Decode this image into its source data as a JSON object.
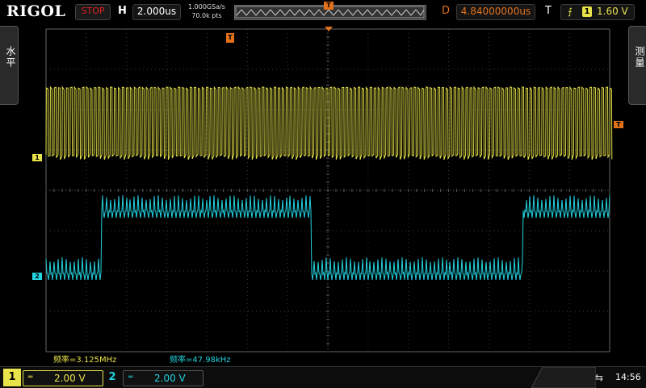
{
  "brand": "RIGOL",
  "status": {
    "run_state": "STOP",
    "run_color": "#e02020"
  },
  "horizontal": {
    "label": "H",
    "timebase": "2.000us",
    "sample_rate": "1.000GSa/s",
    "points": "70.0k pts"
  },
  "delay": {
    "label": "D",
    "value": "4.84000000us"
  },
  "trigger": {
    "label": "T",
    "edge_icon": "rising-edge-icon",
    "source": "1",
    "level": "1.60 V"
  },
  "side_tabs": {
    "left": "水平",
    "right": "测量"
  },
  "channels": [
    {
      "number": "1",
      "coupling": "DC",
      "coupling_symbol": "═",
      "scale": "2.00 V",
      "color": "#e8e34a"
    },
    {
      "number": "2",
      "coupling": "DC",
      "coupling_symbol": "═",
      "scale": "2.00 V",
      "color": "#22d3e0"
    }
  ],
  "markers": {
    "ch1": "1",
    "ch2": "2",
    "trigger": "T"
  },
  "measurements": [
    {
      "channel": "1",
      "text": "频率=3.125MHz"
    },
    {
      "channel": "2",
      "text": "频率=47.98kHz"
    }
  ],
  "system": {
    "usb_icon": "usb-icon",
    "time": "14:56"
  }
}
